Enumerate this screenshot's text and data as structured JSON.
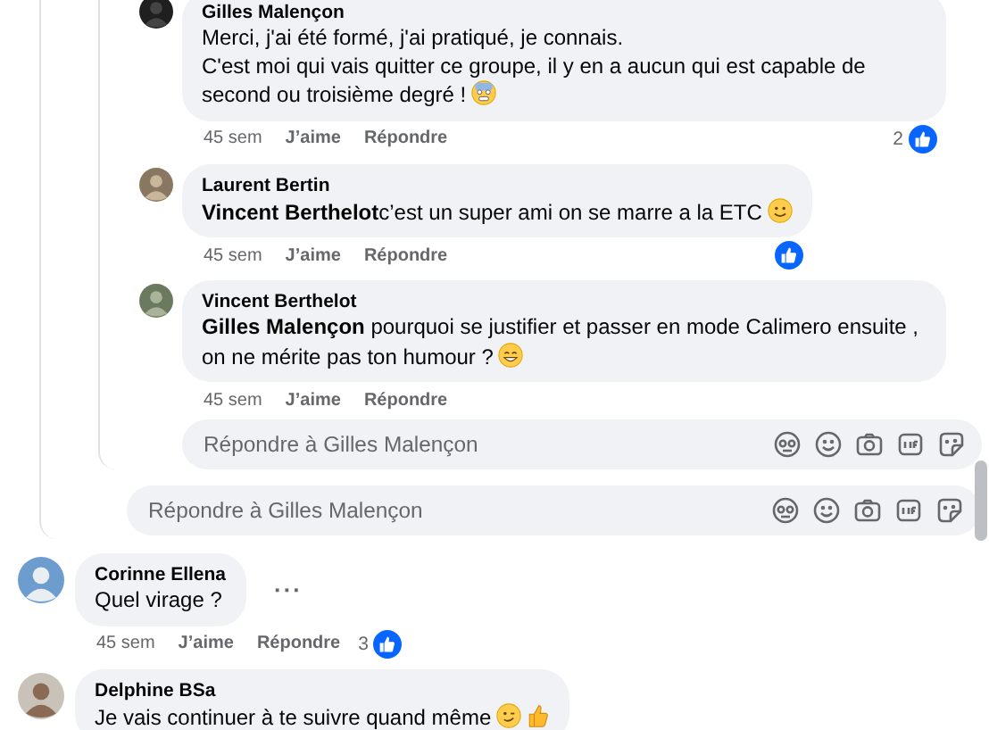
{
  "replies": [
    {
      "author": "Gilles Malençon",
      "text": "Merci, j'ai été formé, j'ai pratiqué, je connais.\nC'est moi qui vais quitter ce groupe, il y en a aucun qui est capable de second ou troisième degré !",
      "emojis": [
        {
          "kind": "cold-sweat"
        }
      ],
      "time": "45 sem",
      "like": "J’aime",
      "reply": "Répondre",
      "reactions": {
        "count": "2",
        "like": true
      }
    },
    {
      "author": "Laurent Bertin",
      "text": "**Vincent Berthelot**c’est un super ami on se marre a la ETC",
      "emojis": [
        {
          "kind": "smile"
        }
      ],
      "time": "45 sem",
      "like": "J’aime",
      "reply": "Répondre",
      "reactions": {
        "like": true
      }
    },
    {
      "author": "Vincent Berthelot",
      "text": "**Gilles Malençon** pourquoi se justifier et passer en mode Calimero ensuite , on ne mérite pas ton humour ?",
      "emojis": [
        {
          "kind": "grin"
        }
      ],
      "time": "45 sem",
      "like": "J’aime",
      "reply": "Répondre"
    }
  ],
  "reply_box": {
    "placeholder": "Répondre à Gilles Malençon"
  },
  "thread_reply_box": {
    "placeholder": "Répondre à Gilles Malençon"
  },
  "comments": [
    {
      "author": "Corinne Ellena",
      "text": "Quel virage ?",
      "more": "···",
      "time": "45 sem",
      "like": "J’aime",
      "reply": "Répondre",
      "reactions": {
        "count": "3",
        "like": true
      }
    },
    {
      "author": "Delphine BSa",
      "text": "Je vais continuer à te suivre quand même",
      "emojis": [
        {
          "kind": "wink"
        },
        {
          "kind": "thumbs-up"
        }
      ]
    }
  ]
}
